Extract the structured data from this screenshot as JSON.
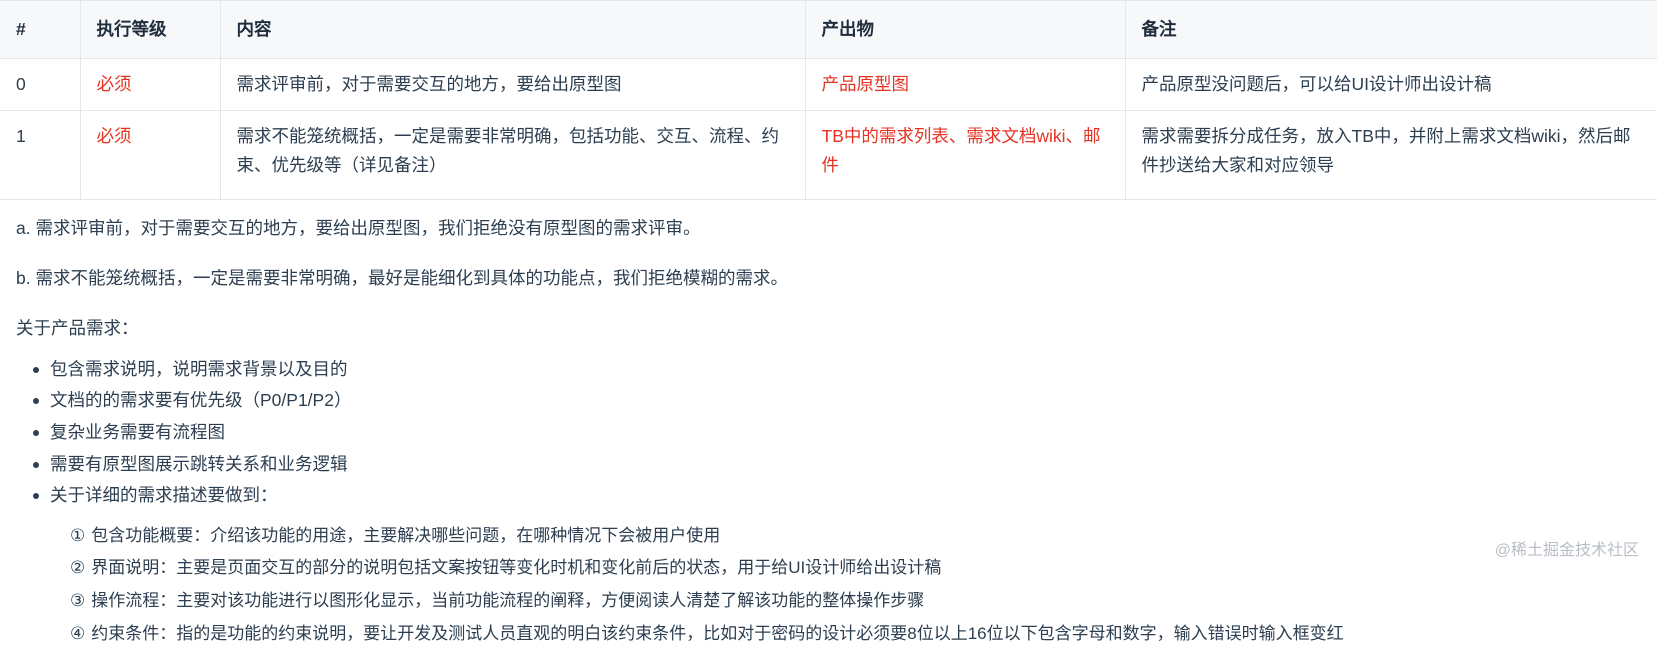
{
  "table": {
    "headers": [
      "#",
      "执行等级",
      "内容",
      "产出物",
      "备注"
    ],
    "rows": [
      {
        "num": "0",
        "level": "必须",
        "content": "需求评审前，对于需要交互的地方，要给出原型图",
        "output": "产品原型图",
        "remark": "产品原型没问题后，可以给UI设计师出设计稿"
      },
      {
        "num": "1",
        "level": "必须",
        "content": "需求不能笼统概括，一定是需要非常明确，包括功能、交互、流程、约束、优先级等（详见备注）",
        "output": "TB中的需求列表、需求文档wiki、邮件",
        "remark": "需求需要拆分成任务，放入TB中，并附上需求文档wiki，然后邮件抄送给大家和对应领导"
      }
    ]
  },
  "notes": [
    "a. 需求评审前，对于需要交互的地方，要给出原型图，我们拒绝没有原型图的需求评审。",
    "b. 需求不能笼统概括，一定是需要非常明确，最好是能细化到具体的功能点，我们拒绝模糊的需求。"
  ],
  "section_label": "关于产品需求：",
  "bullets": [
    "包含需求说明，说明需求背景以及目的",
    "文档的的需求要有优先级（P0/P1/P2）",
    "复杂业务需要有流程图",
    "需要有原型图展示跳转关系和业务逻辑",
    "关于详细的需求描述要做到："
  ],
  "circled_items": [
    {
      "mark": "①",
      "text": "包含功能概要：介绍该功能的用途，主要解决哪些问题，在哪种情况下会被用户使用"
    },
    {
      "mark": "②",
      "text": "界面说明：主要是页面交互的部分的说明包括文案按钮等变化时机和变化前后的状态，用于给UI设计师给出设计稿"
    },
    {
      "mark": "③",
      "text": "操作流程：主要对该功能进行以图形化显示，当前功能流程的阐释，方便阅读人清楚了解该功能的整体操作步骤"
    },
    {
      "mark": "④",
      "text": "约束条件：指的是功能的约束说明，要让开发及测试人员直观的明白该约束条件，比如对于密码的设计必须要8位以上16位以下包含字母和数字，输入错误时输入框变红"
    }
  ],
  "watermark": "@稀土掘金技术社区",
  "colors": {
    "red": "#e63323",
    "text": "#2c3e50",
    "header_bg": "#f7f8fa",
    "border": "#e3e6ea",
    "watermark": "#b9bec7"
  }
}
